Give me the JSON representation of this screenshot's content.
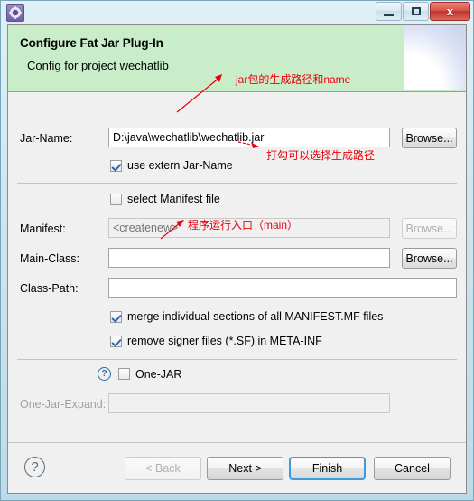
{
  "window": {
    "icon": "gear-icon",
    "controls": {
      "minimize": "Minimize",
      "restore": "Restore",
      "close": "Close",
      "close_glyph": "x"
    }
  },
  "header": {
    "title": "Configure Fat Jar Plug-In",
    "subtitle": "Config for project wechatlib",
    "background_color": "#c9ecc9"
  },
  "form": {
    "jar_name": {
      "label": "Jar-Name:",
      "value": "D:\\java\\wechatlib\\wechatlib.jar",
      "placeholder": "",
      "browse_label": "Browse..."
    },
    "use_extern": {
      "label": "use extern Jar-Name",
      "checked": true
    },
    "select_manifest": {
      "label": "select Manifest file",
      "checked": false
    },
    "manifest": {
      "label": "Manifest:",
      "value": "",
      "placeholder": "<createnew>",
      "browse_label": "Browse...",
      "disabled": true
    },
    "main_class": {
      "label": "Main-Class:",
      "value": "",
      "placeholder": "",
      "browse_label": "Browse..."
    },
    "class_path": {
      "label": "Class-Path:",
      "value": "",
      "placeholder": ""
    },
    "merge_sections": {
      "label": "merge individual-sections of all MANIFEST.MF files",
      "checked": true
    },
    "remove_signer": {
      "label": "remove signer files (*.SF) in META-INF",
      "checked": true
    },
    "one_jar": {
      "label": "One-JAR",
      "checked": false,
      "help_glyph": "?"
    },
    "one_jar_expand": {
      "label": "One-Jar-Expand:",
      "value": "",
      "placeholder": "",
      "disabled": true
    }
  },
  "buttons": {
    "help_glyph": "?",
    "back": "< Back",
    "next": "Next >",
    "finish": "Finish",
    "cancel": "Cancel"
  },
  "annotations": {
    "color": "#e8000a",
    "items": [
      {
        "text": "jar包的生成路径和name"
      },
      {
        "text": "打勾可以选择生成路径"
      },
      {
        "text": "程序运行入口（main）"
      }
    ]
  }
}
